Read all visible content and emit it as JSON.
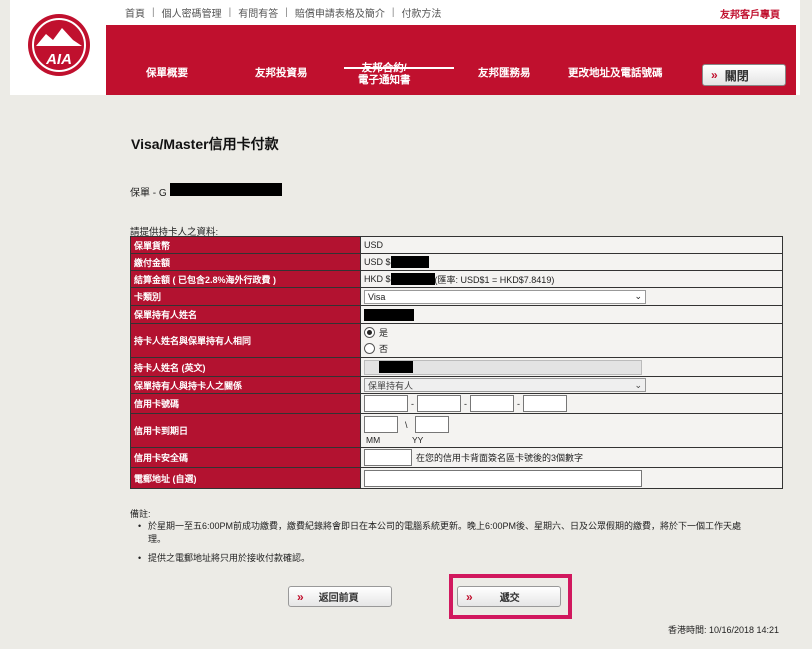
{
  "brand": {
    "logo_text": "AIA",
    "accent": "#c0102e"
  },
  "topnav": {
    "links": [
      "首頁",
      "個人密碼管理",
      "有問有答",
      "賠償申請表格及簡介",
      "付款方法"
    ],
    "portal": "友邦客戶專頁"
  },
  "mainnav": {
    "items": [
      "保單概要",
      "友邦投資易",
      "友邦合約/\n電子通知書",
      "友邦匯務易",
      "更改地址及電話號碼"
    ],
    "close_label": "關閉"
  },
  "page": {
    "title": "Visa/Master信用卡付款",
    "policy_label": "保單 - G",
    "intro": "請提供持卡人之資料:"
  },
  "form": {
    "currency_label": "保單貨幣",
    "currency_value": "USD",
    "total_label": "繳付金額",
    "total_prefix": "USD $",
    "settle_label": "結算金額 ( 已包含2.8%海外行政費 )",
    "settle_prefix": "HKD $",
    "settle_rate": "(匯率: USD$1 = HKD$7.8419)",
    "card_type_label": "卡類別",
    "card_type_value": "Visa",
    "holder_name_label": "保單持有人姓名",
    "same_label": "持卡人姓名與保單持有人相同",
    "same_yes": "是",
    "same_no": "否",
    "cardholder_en_label": "持卡人姓名 (英文)",
    "relation_label": "保單持有人與持卡人之關係",
    "relation_value": "保單持有人",
    "card_no_label": "信用卡號碼",
    "expiry_label": "信用卡到期日",
    "expiry_mm": "MM",
    "expiry_yy": "YY",
    "expiry_sep": "\\",
    "cvv_label": "信用卡安全碼",
    "cvv_hint": "在您的信用卡背面簽名區卡號後的3個數字",
    "email_label": "電郵地址 (自選)"
  },
  "notes": {
    "title": "備註:",
    "items": [
      "於星期一至五6:00PM前成功繳費，繳費紀錄將會即日在本公司的電腦系統更新。晚上6:00PM後、星期六、日及公眾假期的繳費，將於下一個工作天處",
      "理。",
      "提供之電郵地址將只用於接收付款確認。"
    ]
  },
  "buttons": {
    "back": "返回前頁",
    "submit": "遞交"
  },
  "footer": {
    "hk_time": "香港時間: 10/16/2018 14:21"
  }
}
